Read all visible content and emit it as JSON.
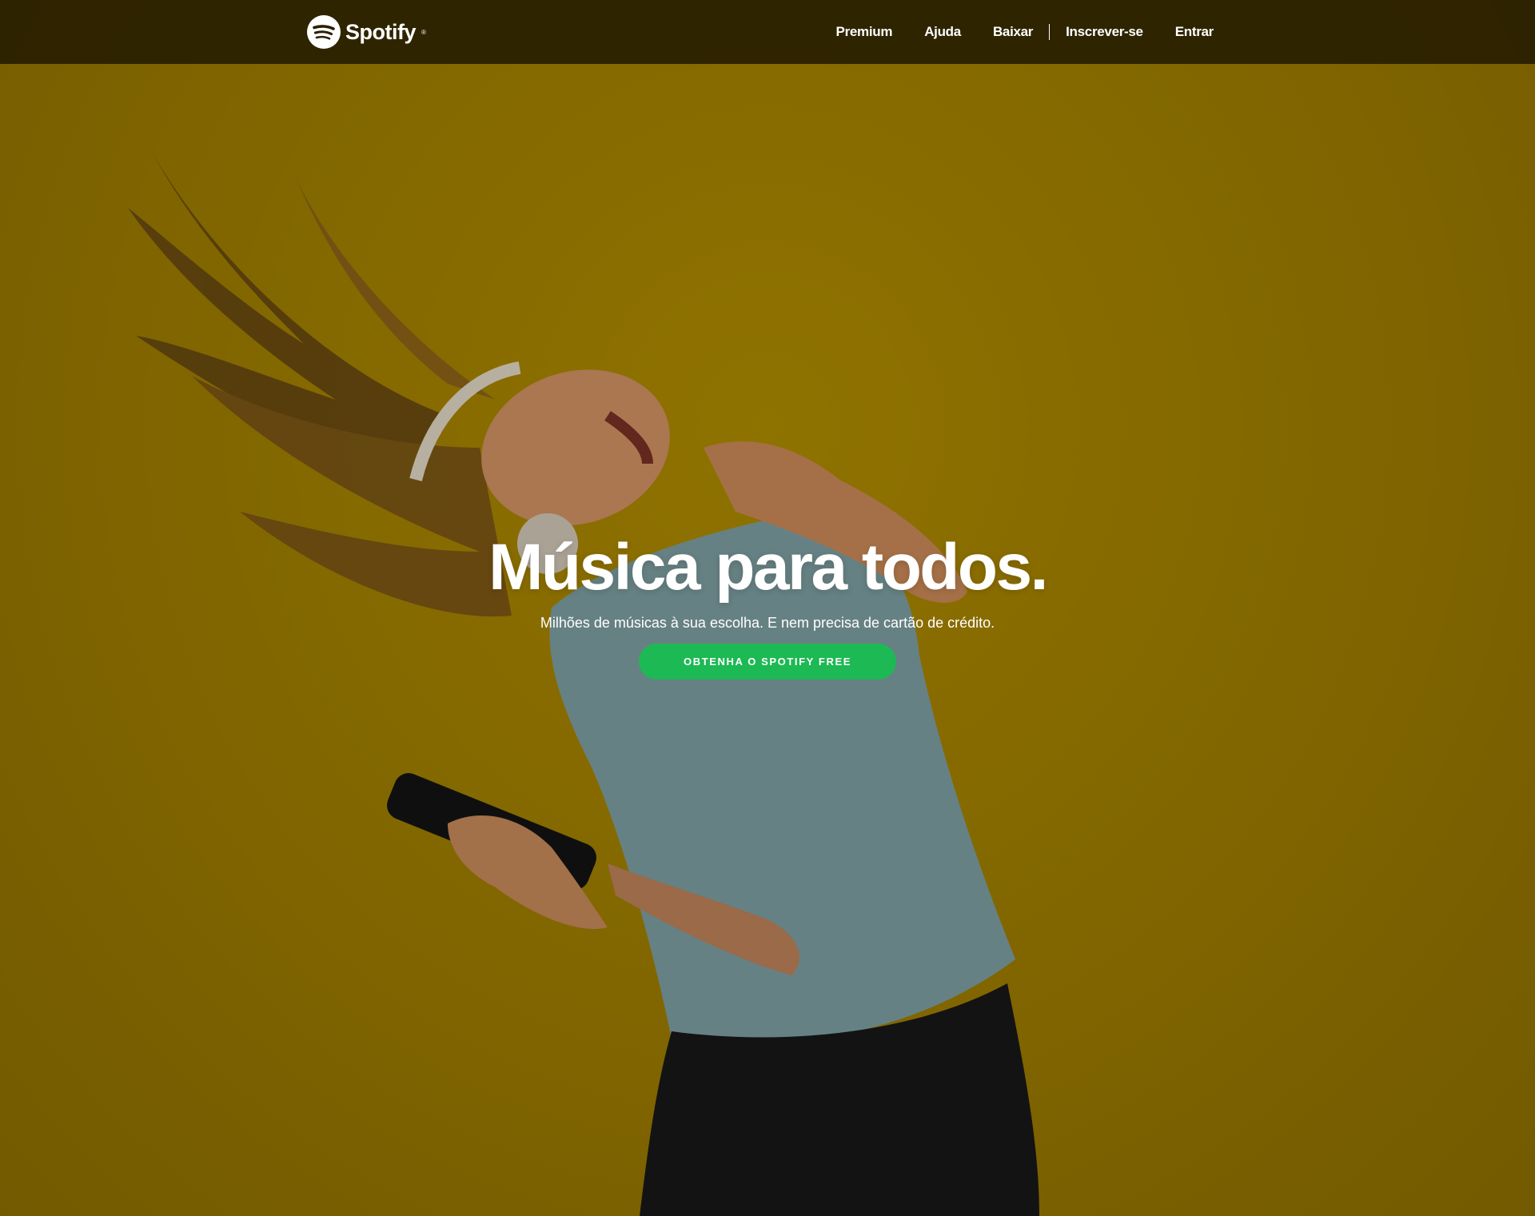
{
  "navbar": {
    "brand": "Spotify",
    "links": [
      "Premium",
      "Ajuda",
      "Baixar"
    ],
    "account_links": [
      "Inscrever-se",
      "Entrar"
    ]
  },
  "hero": {
    "title": "Música para todos.",
    "subtitle": "Milhões de músicas à sua escolha. E nem precisa de cartão de crédito.",
    "cta_label": "OBTENHA O SPOTIFY FREE"
  },
  "colors": {
    "navbar_bg": "#2a1f00",
    "hero_bg": "#8f7100",
    "cta_green": "#1db954",
    "text": "#ffffff"
  },
  "icons": [
    "spotify-logo-icon"
  ]
}
